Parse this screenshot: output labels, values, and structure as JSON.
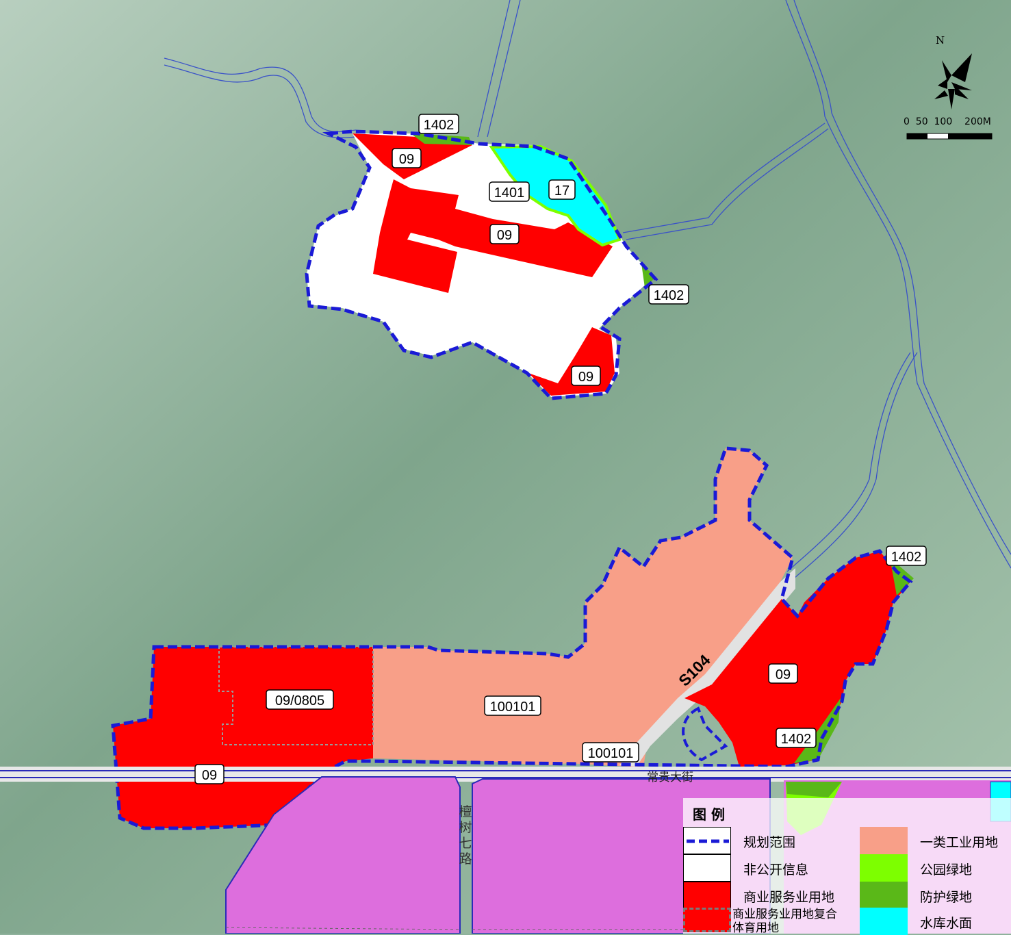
{
  "north_label": "N",
  "scale_label": "0  50  100    200M",
  "parcels": {
    "north_top_green": "1402",
    "north_comm_1": "09",
    "north_white": "1401",
    "north_water": "17",
    "north_comm_2": "09",
    "north_east_green": "1402",
    "north_comm_3": "09",
    "south_mixed": "09/0805",
    "south_comm_west": "09",
    "south_industrial": "100101",
    "south_industrial_2": "100101",
    "east_comm": "09",
    "east_green_top": "1402",
    "east_green_bottom": "1402"
  },
  "roads": {
    "s104": "S104",
    "changgui": "常贵大街",
    "tanshu7": "檀树七路"
  },
  "legend": {
    "title": "图 例",
    "items": [
      {
        "label": "规划范围",
        "color": "#1a1ad6"
      },
      {
        "label": "非公开信息",
        "color": "#ffffff"
      },
      {
        "label": "商业服务业用地",
        "color": "#ff0000"
      },
      {
        "label": "商业服务业用地复合体育用地",
        "color": "#ff0000"
      },
      {
        "label": "一类工业用地",
        "color": "#f89f88"
      },
      {
        "label": "公园绿地",
        "color": "#7dff00"
      },
      {
        "label": "防护绿地",
        "color": "#5ab818"
      },
      {
        "label": "水库水面",
        "color": "#00ffff"
      }
    ]
  }
}
